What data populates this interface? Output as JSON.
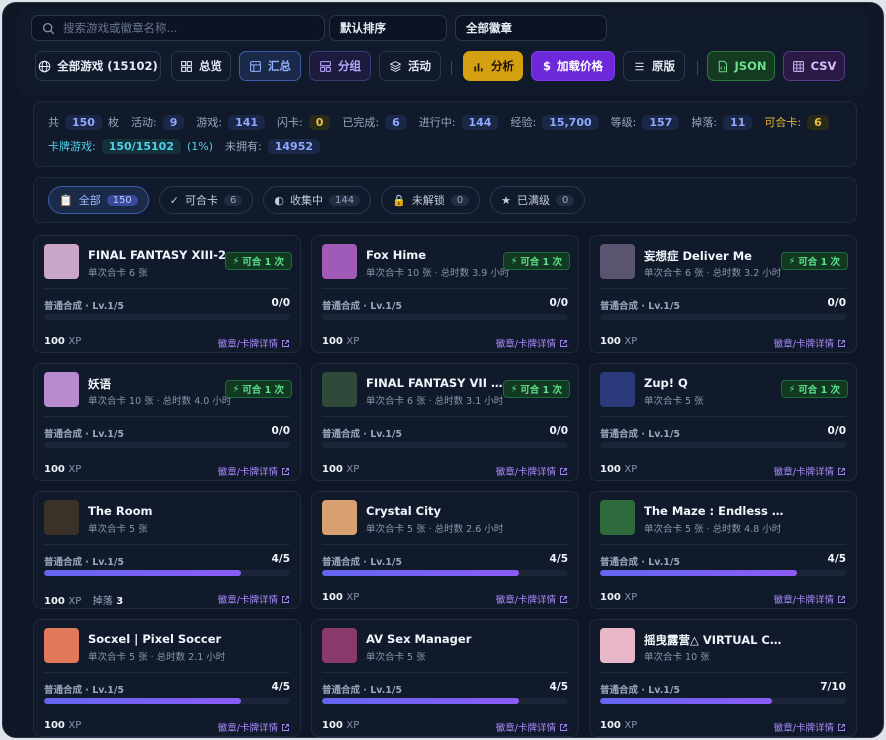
{
  "search": {
    "placeholder": "搜索游戏或徽章名称..."
  },
  "sort_select": {
    "value": "默认排序"
  },
  "badge_select": {
    "value": "全部徽章"
  },
  "toolbar": {
    "all_games": "全部游戏 (15102)",
    "overview": "总览",
    "summary": "汇总",
    "group": "分组",
    "activity": "活动",
    "analysis": "分析",
    "load_price": "加载价格",
    "original": "原版",
    "json": "JSON",
    "csv": "CSV"
  },
  "stats": {
    "total_label": "共",
    "total": "150",
    "unit": "枚",
    "activity_label": "活动:",
    "activity": "9",
    "games_label": "游戏:",
    "games": "141",
    "foil_label": "闪卡:",
    "foil": "0",
    "done_label": "已完成:",
    "done": "6",
    "progress_label": "进行中:",
    "progress": "144",
    "xp_label": "经验:",
    "xp": "15,700",
    "level_label": "等级:",
    "level": "157",
    "drops_label": "掉落:",
    "drops": "11",
    "craftable_label": "可合卡:",
    "craftable": "6",
    "card_games_label": "卡牌游戏:",
    "card_games": "150/15102",
    "card_games_pct": "(1%)",
    "unowned_label": "未拥有:",
    "unowned": "14952"
  },
  "tabs": [
    {
      "label": "全部",
      "count": "150"
    },
    {
      "label": "可合卡",
      "count": "6"
    },
    {
      "label": "收集中",
      "count": "144"
    },
    {
      "label": "未解锁",
      "count": "0"
    },
    {
      "label": "已满级",
      "count": "0"
    }
  ],
  "common": {
    "craft_label": "可合 1 次",
    "progress_label": "普通合成 · Lv.1/5",
    "xp_unit": "XP",
    "detail_link": "徽章/卡牌详情",
    "drop_label": "掉落"
  },
  "cards": [
    {
      "name": "FINAL FANTASY XIII-2",
      "meta": "单次合卡 6 张",
      "craft": true,
      "progress": "0/0",
      "ratio": 0,
      "xp": "100",
      "drops": "",
      "level": "普通合成 · Lv.1/5",
      "thumb": "#c9a6c8"
    },
    {
      "name": "Fox Hime",
      "meta": "单次合卡 10 张 · 总时数 3.9 小时",
      "craft": true,
      "progress": "0/0",
      "ratio": 0,
      "xp": "100",
      "drops": "",
      "level": "普通合成 · Lv.1/5",
      "thumb": "#a05ab8"
    },
    {
      "name": "妄想症 Deliver Me",
      "meta": "单次合卡 6 张 · 总时数 3.2 小时",
      "craft": true,
      "progress": "0/0",
      "ratio": 0,
      "xp": "100",
      "drops": "",
      "level": "普通合成 · Lv.1/5",
      "thumb": "#5a5470"
    },
    {
      "name": "妖语",
      "meta": "单次合卡 10 张 · 总时数 4.0 小时",
      "craft": true,
      "progress": "0/0",
      "ratio": 0,
      "xp": "100",
      "drops": "",
      "level": "普通合成 · Lv.1/5",
      "thumb": "#b88ad0"
    },
    {
      "name": "FINAL FANTASY VII RE...",
      "meta": "单次合卡 6 张 · 总时数 3.1 小时",
      "craft": true,
      "progress": "0/0",
      "ratio": 0,
      "xp": "100",
      "drops": "",
      "level": "普通合成 · Lv.1/5",
      "thumb": "#2f4a3a"
    },
    {
      "name": "Zup! Q",
      "meta": "单次合卡 5 张",
      "craft": true,
      "progress": "0/0",
      "ratio": 0,
      "xp": "100",
      "drops": "",
      "level": "普通合成 · Lv.1/5",
      "thumb": "#2a3a7a"
    },
    {
      "name": "The Room",
      "meta": "单次合卡 5 张",
      "craft": false,
      "progress": "4/5",
      "ratio": 0.8,
      "xp": "100",
      "drops": "3",
      "level": "普通合成 · Lv.1/5",
      "thumb": "#3a3228"
    },
    {
      "name": "Crystal City",
      "meta": "单次合卡 5 张 · 总时数 2.6 小时",
      "craft": false,
      "progress": "4/5",
      "ratio": 0.8,
      "xp": "100",
      "drops": "",
      "level": "普通合成 · Lv.1/5",
      "thumb": "#d8a070"
    },
    {
      "name": "The Maze : Endless nightmare",
      "meta": "单次合卡 5 张 · 总时数 4.8 小时",
      "craft": false,
      "progress": "4/5",
      "ratio": 0.8,
      "xp": "100",
      "drops": "",
      "level": "普通合成 · Lv.1/5",
      "thumb": "#2e6a3c"
    },
    {
      "name": "Socxel | Pixel Soccer",
      "meta": "单次合卡 5 张 · 总时数 2.1 小时",
      "craft": false,
      "progress": "4/5",
      "ratio": 0.8,
      "xp": "100",
      "drops": "",
      "level": "普通合成 · Lv.1/5",
      "thumb": "#e07a5a"
    },
    {
      "name": "AV Sex Manager",
      "meta": "单次合卡 5 张",
      "craft": false,
      "progress": "4/5",
      "ratio": 0.8,
      "xp": "100",
      "drops": "",
      "level": "普通合成 · Lv.1/5",
      "thumb": "#8a3a6a"
    },
    {
      "name": "摇曳露营△ VIRTUAL CAMP ～山麓露营...",
      "meta": "单次合卡 10 张",
      "craft": false,
      "progress": "7/10",
      "ratio": 0.7,
      "xp": "100",
      "drops": "",
      "level": "普通合成 · Lv.1/5",
      "thumb": "#e8b8c8"
    }
  ]
}
